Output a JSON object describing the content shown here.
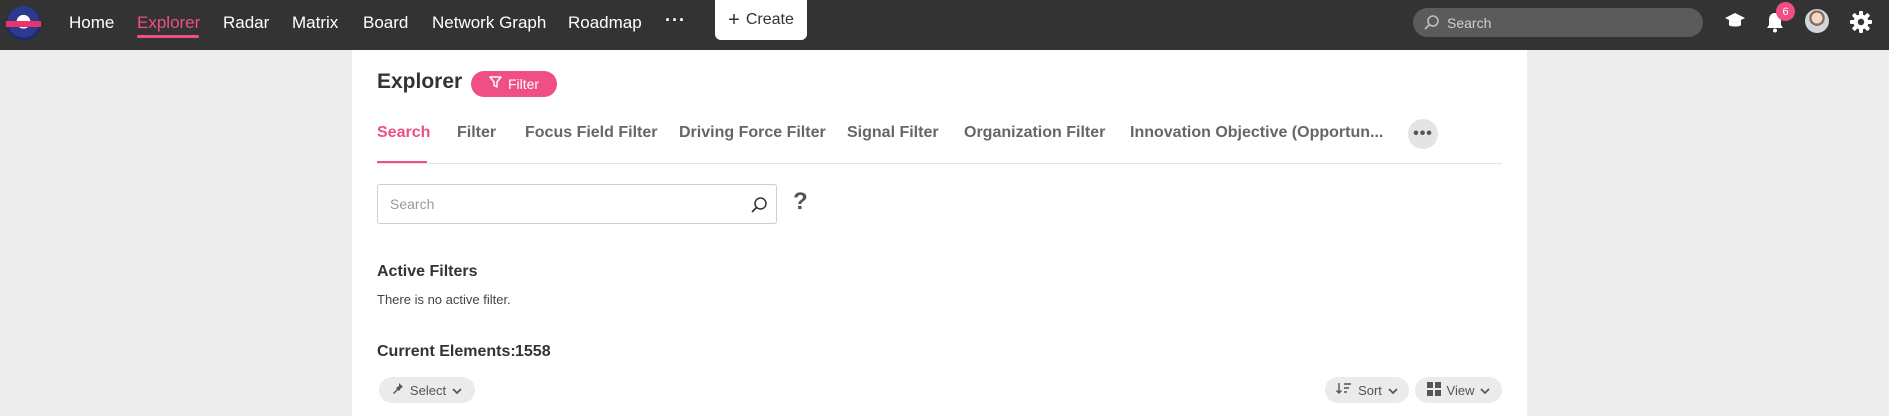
{
  "nav": {
    "items": [
      {
        "label": "Home"
      },
      {
        "label": "Explorer"
      },
      {
        "label": "Radar"
      },
      {
        "label": "Matrix"
      },
      {
        "label": "Board"
      },
      {
        "label": "Network Graph"
      },
      {
        "label": "Roadmap"
      }
    ],
    "more_label": "···",
    "create_label": "Create",
    "search_placeholder": "Search",
    "notification_count": "6"
  },
  "page": {
    "title": "Explorer",
    "filter_button_label": "Filter",
    "tabs": [
      {
        "label": "Search"
      },
      {
        "label": "Filter"
      },
      {
        "label": "Focus Field Filter"
      },
      {
        "label": "Driving Force Filter"
      },
      {
        "label": "Signal Filter"
      },
      {
        "label": "Organization Filter"
      },
      {
        "label": "Innovation Objective (Opportun..."
      }
    ],
    "tabs_more_label": "•••",
    "search_placeholder": "Search",
    "help_label": "?",
    "active_filters_heading": "Active Filters",
    "no_filter_text": "There is no active filter.",
    "current_elements_label": "Current Elements:",
    "current_elements_count": "1558",
    "select_label": "Select",
    "sort_label": "Sort",
    "view_label": "View"
  },
  "colors": {
    "accent": "#ef4f86",
    "topbar": "#333333"
  }
}
